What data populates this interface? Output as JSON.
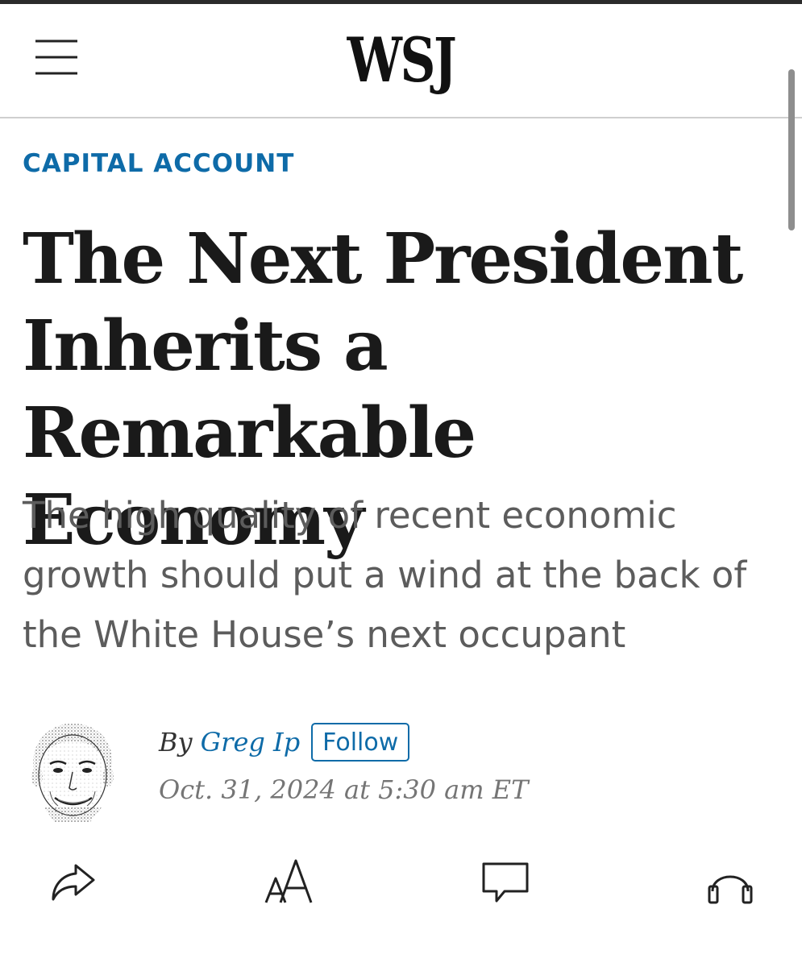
{
  "header": {
    "logo": "WSJ",
    "menu_icon": "hamburger-menu-icon"
  },
  "article": {
    "kicker": "CAPITAL ACCOUNT",
    "headline_lines": [
      "The Next President",
      "Inherits a Remarkable",
      "Economy"
    ],
    "dek_lines": [
      "The high quality of recent economic",
      "growth should put a wind at the back of",
      "the White House’s next occupant"
    ],
    "byline": {
      "prefix": "By",
      "author": "Greg Ip",
      "follow_label": "Follow",
      "date": "Oct. 31, 2024 at 5:30 am ET"
    }
  },
  "toolbar": {
    "share_icon": "share-icon",
    "text_size_icon": "text-size-icon",
    "comments_icon": "comments-icon",
    "listen_icon": "headphones-icon"
  },
  "colors": {
    "accent": "#0e6ba8",
    "headline": "#1a1a1a",
    "dek": "#5c5c5c",
    "date": "#757575"
  }
}
